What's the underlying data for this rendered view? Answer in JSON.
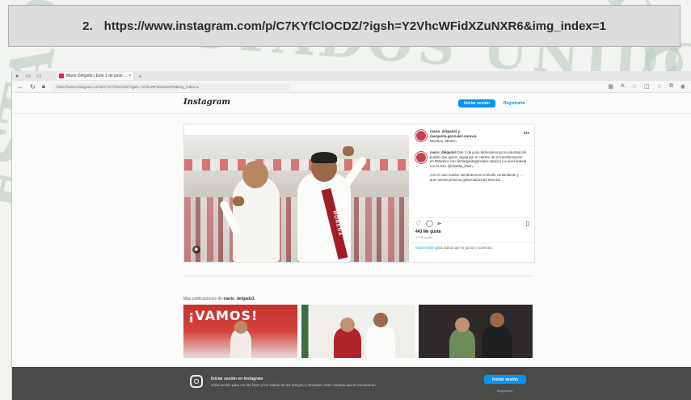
{
  "caption": {
    "number": "2.",
    "url": "https://www.instagram.com/p/C7KYfClOCDZ/?igsh=Y2VhcWFidXZuNXR6&img_index=1"
  },
  "watermark": {
    "arc": "ESTADOS UNIDOS MEXICANOS",
    "left": "ESTADOS",
    "right": "CANOS"
  },
  "browser": {
    "tab_title": "Mario Delgado | Este 2 de junio ...",
    "address": "https://www.instagram.com/p/C7KYfClOCDZ/?igsh=Y2VhcWFidXZuNXR6&img_index=1"
  },
  "instagram": {
    "logo": "Instagram",
    "login_button": "Iniciar sesión",
    "signup_link": "Registrarte",
    "post": {
      "account": "mario_delgadol y",
      "coauthor": "margarita.gonzalez.saravia",
      "location": "Morelos, Mexico",
      "caption_user": "mario_delgadol",
      "caption_text": "Este 2 de junio defenderemos la voluntad del pueblo que quiere seguir por el camino de la transformación en #Morelos con @margaritagonzalez.saravia y a nivel federal con la Dra. @claudia_shein...",
      "caption_more": "Con el voto masivo sembraremos el triunfo contundente y ... que nuestra próxima gobernadora de Morelos ...",
      "photo_sash": "MORENA",
      "likes": "443 Me gusta",
      "date": "19 de mayo",
      "login_prompt_link": "Inicia sesión",
      "login_prompt_text": " para indicar que te gusta o comentar."
    },
    "more_posts_label": "Más publicaciones de ",
    "more_posts_user": "mario_delgado1",
    "thumb1_text": "¡VAMOS!",
    "cookie_title": "Iniciar sesión en Instagram",
    "cookie_text": "Inicia sesión para ver las fotos y los videos de tus amigos y descubrir otras cuentas que te encantarán.",
    "cookie_button": "Iniciar sesión",
    "cookie_link": "Registrarte"
  }
}
